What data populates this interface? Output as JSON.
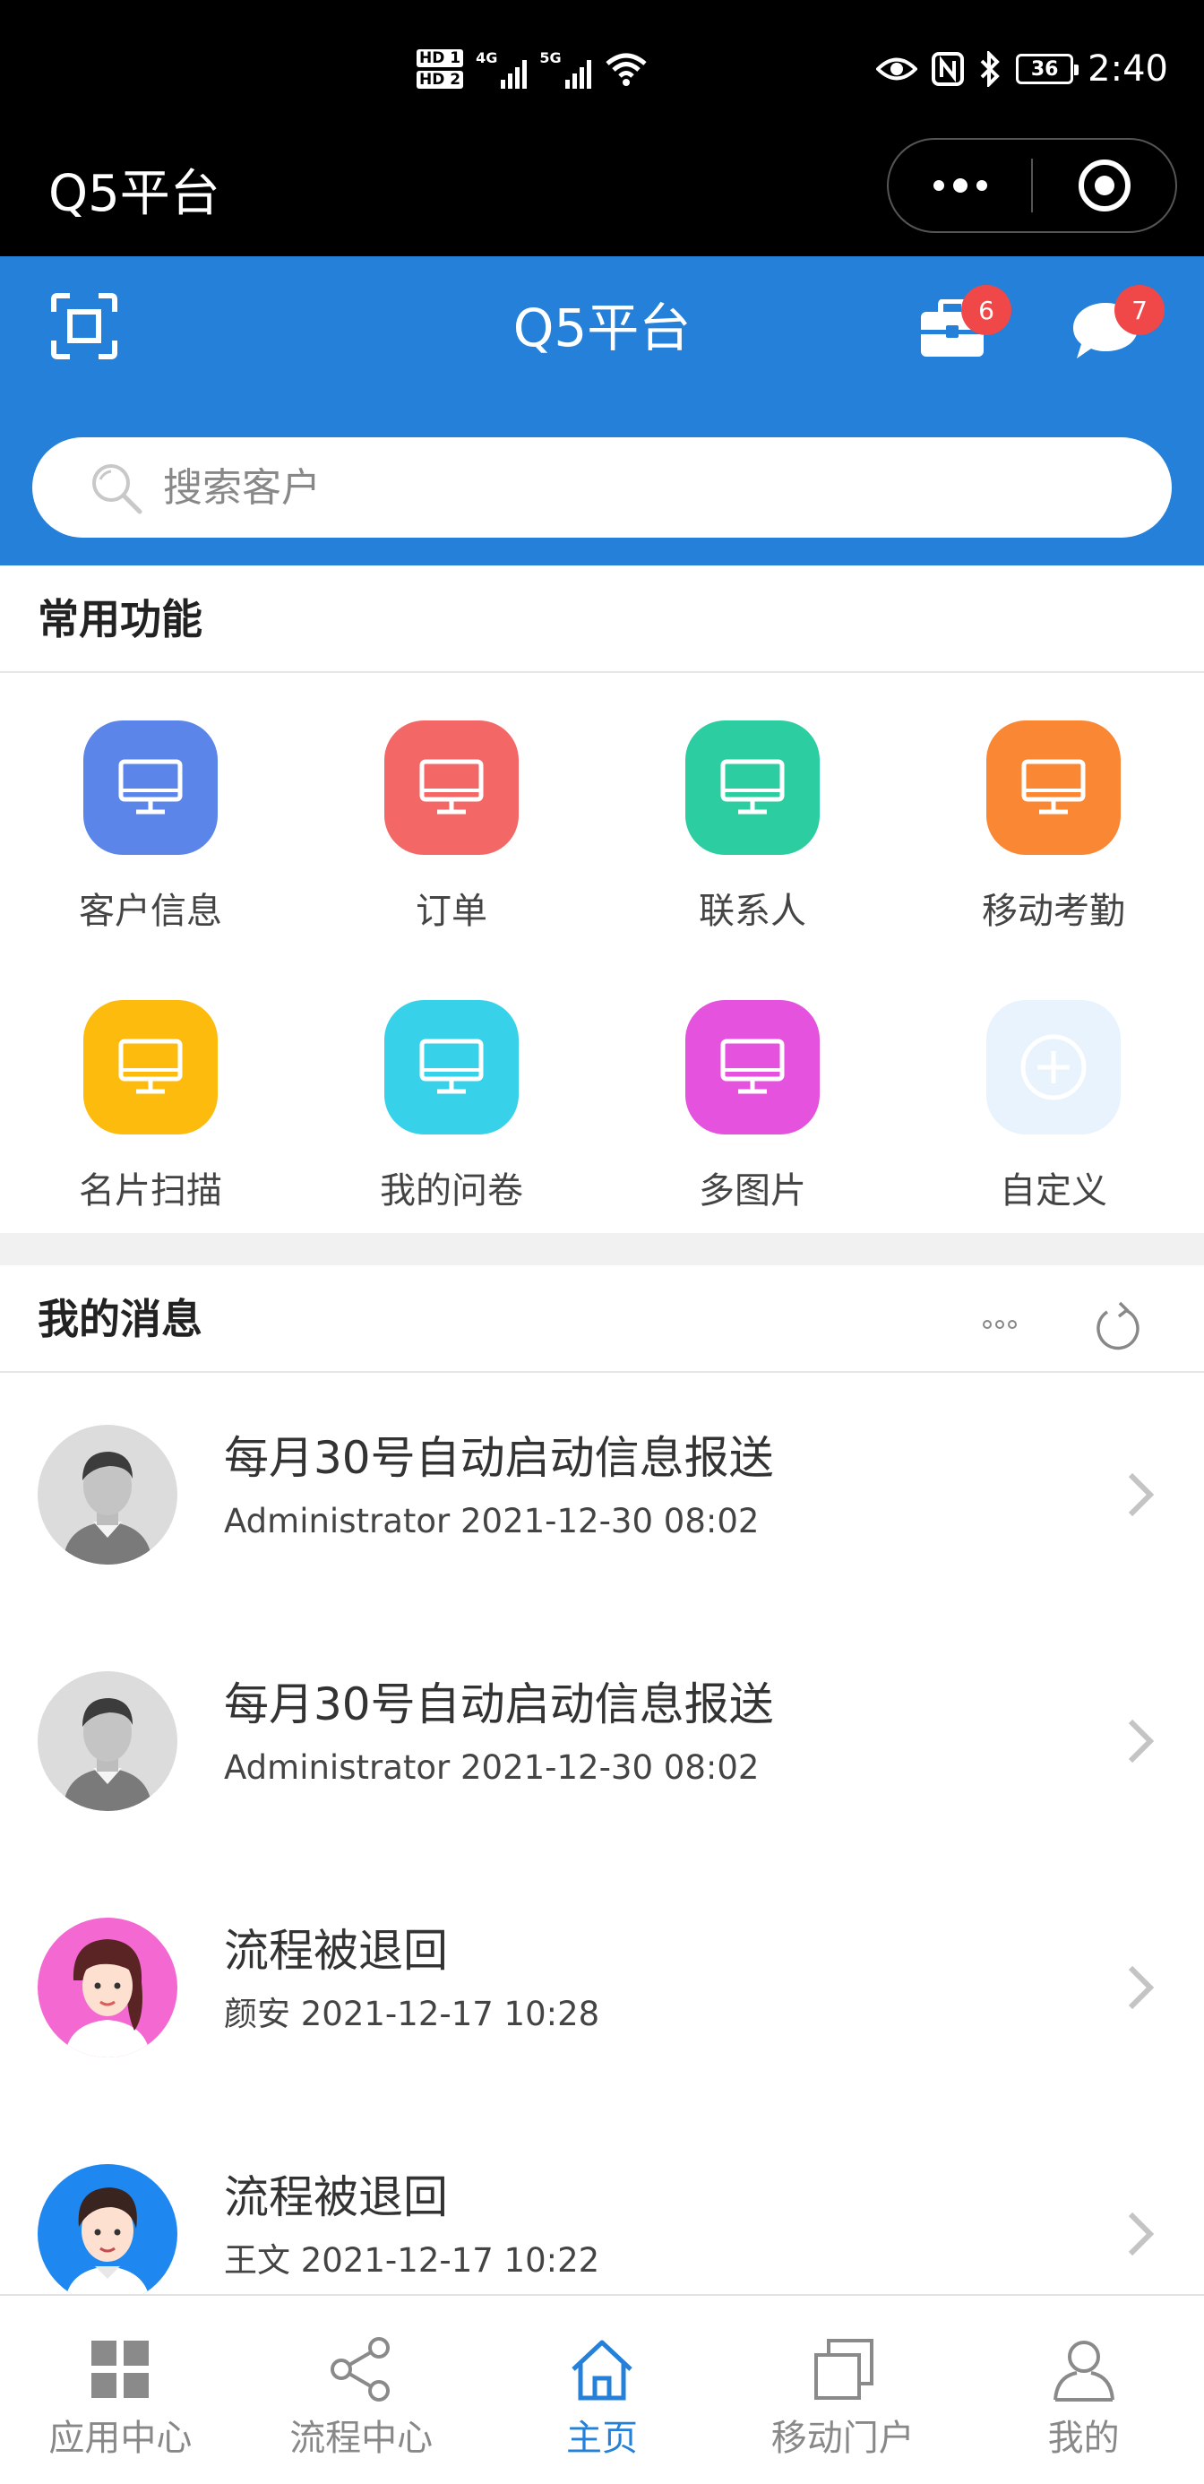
{
  "status_bar": {
    "hd1": "HD 1",
    "hd2": "HD 2",
    "net1": "4G",
    "net2": "5G",
    "battery": "36",
    "time": "2:40"
  },
  "mini_program": {
    "title": "Q5平台"
  },
  "header": {
    "title": "Q5平台",
    "tool_badge": "6",
    "message_badge": "7",
    "search_placeholder": "搜索客户",
    "accent_color": "#2480d8",
    "badge_color": "#f04848"
  },
  "common_functions": {
    "title": "常用功能",
    "items": [
      {
        "label": "客户信息",
        "color": "#5b85e8",
        "icon": "monitor-icon"
      },
      {
        "label": "订单",
        "color": "#f46767",
        "icon": "monitor-icon"
      },
      {
        "label": "联系人",
        "color": "#2ccda0",
        "icon": "monitor-icon"
      },
      {
        "label": "移动考勤",
        "color": "#f98734",
        "icon": "monitor-icon"
      },
      {
        "label": "名片扫描",
        "color": "#fdbb0e",
        "icon": "monitor-icon"
      },
      {
        "label": "我的问卷",
        "color": "#37d2ea",
        "icon": "monitor-icon"
      },
      {
        "label": "多图片",
        "color": "#e452de",
        "icon": "monitor-icon"
      },
      {
        "label": "自定义",
        "color": "#e8f3fd",
        "icon": "plus-circle-icon"
      }
    ]
  },
  "my_messages": {
    "title": "我的消息",
    "items": [
      {
        "title": "每月30号自动启动信息报送",
        "meta": "Administrator 2021-12-30 08:02",
        "avatar": "default-male-avatar"
      },
      {
        "title": "每月30号自动启动信息报送",
        "meta": "Administrator 2021-12-30 08:02",
        "avatar": "default-male-avatar"
      },
      {
        "title": "流程被退回",
        "meta": "颜安 2021-12-17 10:28",
        "avatar": "female-avatar"
      },
      {
        "title": "流程被退回",
        "meta": "王文 2021-12-17 10:22",
        "avatar": "male-avatar"
      }
    ]
  },
  "tab_bar": {
    "items": [
      {
        "label": "应用中心",
        "icon": "grid-icon",
        "active": false
      },
      {
        "label": "流程中心",
        "icon": "share-icon",
        "active": false
      },
      {
        "label": "主页",
        "icon": "home-icon",
        "active": true
      },
      {
        "label": "移动门户",
        "icon": "windows-icon",
        "active": false
      },
      {
        "label": "我的",
        "icon": "person-icon",
        "active": false
      }
    ]
  }
}
